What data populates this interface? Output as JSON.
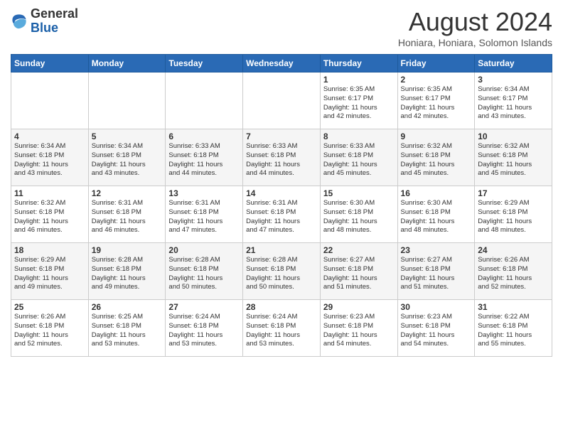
{
  "header": {
    "logo_general": "General",
    "logo_blue": "Blue",
    "month_year": "August 2024",
    "location": "Honiara, Honiara, Solomon Islands"
  },
  "weekdays": [
    "Sunday",
    "Monday",
    "Tuesday",
    "Wednesday",
    "Thursday",
    "Friday",
    "Saturday"
  ],
  "weeks": [
    [
      {
        "day": "",
        "info": ""
      },
      {
        "day": "",
        "info": ""
      },
      {
        "day": "",
        "info": ""
      },
      {
        "day": "",
        "info": ""
      },
      {
        "day": "1",
        "info": "Sunrise: 6:35 AM\nSunset: 6:17 PM\nDaylight: 11 hours\nand 42 minutes."
      },
      {
        "day": "2",
        "info": "Sunrise: 6:35 AM\nSunset: 6:17 PM\nDaylight: 11 hours\nand 42 minutes."
      },
      {
        "day": "3",
        "info": "Sunrise: 6:34 AM\nSunset: 6:17 PM\nDaylight: 11 hours\nand 43 minutes."
      }
    ],
    [
      {
        "day": "4",
        "info": "Sunrise: 6:34 AM\nSunset: 6:18 PM\nDaylight: 11 hours\nand 43 minutes."
      },
      {
        "day": "5",
        "info": "Sunrise: 6:34 AM\nSunset: 6:18 PM\nDaylight: 11 hours\nand 43 minutes."
      },
      {
        "day": "6",
        "info": "Sunrise: 6:33 AM\nSunset: 6:18 PM\nDaylight: 11 hours\nand 44 minutes."
      },
      {
        "day": "7",
        "info": "Sunrise: 6:33 AM\nSunset: 6:18 PM\nDaylight: 11 hours\nand 44 minutes."
      },
      {
        "day": "8",
        "info": "Sunrise: 6:33 AM\nSunset: 6:18 PM\nDaylight: 11 hours\nand 45 minutes."
      },
      {
        "day": "9",
        "info": "Sunrise: 6:32 AM\nSunset: 6:18 PM\nDaylight: 11 hours\nand 45 minutes."
      },
      {
        "day": "10",
        "info": "Sunrise: 6:32 AM\nSunset: 6:18 PM\nDaylight: 11 hours\nand 45 minutes."
      }
    ],
    [
      {
        "day": "11",
        "info": "Sunrise: 6:32 AM\nSunset: 6:18 PM\nDaylight: 11 hours\nand 46 minutes."
      },
      {
        "day": "12",
        "info": "Sunrise: 6:31 AM\nSunset: 6:18 PM\nDaylight: 11 hours\nand 46 minutes."
      },
      {
        "day": "13",
        "info": "Sunrise: 6:31 AM\nSunset: 6:18 PM\nDaylight: 11 hours\nand 47 minutes."
      },
      {
        "day": "14",
        "info": "Sunrise: 6:31 AM\nSunset: 6:18 PM\nDaylight: 11 hours\nand 47 minutes."
      },
      {
        "day": "15",
        "info": "Sunrise: 6:30 AM\nSunset: 6:18 PM\nDaylight: 11 hours\nand 48 minutes."
      },
      {
        "day": "16",
        "info": "Sunrise: 6:30 AM\nSunset: 6:18 PM\nDaylight: 11 hours\nand 48 minutes."
      },
      {
        "day": "17",
        "info": "Sunrise: 6:29 AM\nSunset: 6:18 PM\nDaylight: 11 hours\nand 48 minutes."
      }
    ],
    [
      {
        "day": "18",
        "info": "Sunrise: 6:29 AM\nSunset: 6:18 PM\nDaylight: 11 hours\nand 49 minutes."
      },
      {
        "day": "19",
        "info": "Sunrise: 6:28 AM\nSunset: 6:18 PM\nDaylight: 11 hours\nand 49 minutes."
      },
      {
        "day": "20",
        "info": "Sunrise: 6:28 AM\nSunset: 6:18 PM\nDaylight: 11 hours\nand 50 minutes."
      },
      {
        "day": "21",
        "info": "Sunrise: 6:28 AM\nSunset: 6:18 PM\nDaylight: 11 hours\nand 50 minutes."
      },
      {
        "day": "22",
        "info": "Sunrise: 6:27 AM\nSunset: 6:18 PM\nDaylight: 11 hours\nand 51 minutes."
      },
      {
        "day": "23",
        "info": "Sunrise: 6:27 AM\nSunset: 6:18 PM\nDaylight: 11 hours\nand 51 minutes."
      },
      {
        "day": "24",
        "info": "Sunrise: 6:26 AM\nSunset: 6:18 PM\nDaylight: 11 hours\nand 52 minutes."
      }
    ],
    [
      {
        "day": "25",
        "info": "Sunrise: 6:26 AM\nSunset: 6:18 PM\nDaylight: 11 hours\nand 52 minutes."
      },
      {
        "day": "26",
        "info": "Sunrise: 6:25 AM\nSunset: 6:18 PM\nDaylight: 11 hours\nand 53 minutes."
      },
      {
        "day": "27",
        "info": "Sunrise: 6:24 AM\nSunset: 6:18 PM\nDaylight: 11 hours\nand 53 minutes."
      },
      {
        "day": "28",
        "info": "Sunrise: 6:24 AM\nSunset: 6:18 PM\nDaylight: 11 hours\nand 53 minutes."
      },
      {
        "day": "29",
        "info": "Sunrise: 6:23 AM\nSunset: 6:18 PM\nDaylight: 11 hours\nand 54 minutes."
      },
      {
        "day": "30",
        "info": "Sunrise: 6:23 AM\nSunset: 6:18 PM\nDaylight: 11 hours\nand 54 minutes."
      },
      {
        "day": "31",
        "info": "Sunrise: 6:22 AM\nSunset: 6:18 PM\nDaylight: 11 hours\nand 55 minutes."
      }
    ]
  ]
}
